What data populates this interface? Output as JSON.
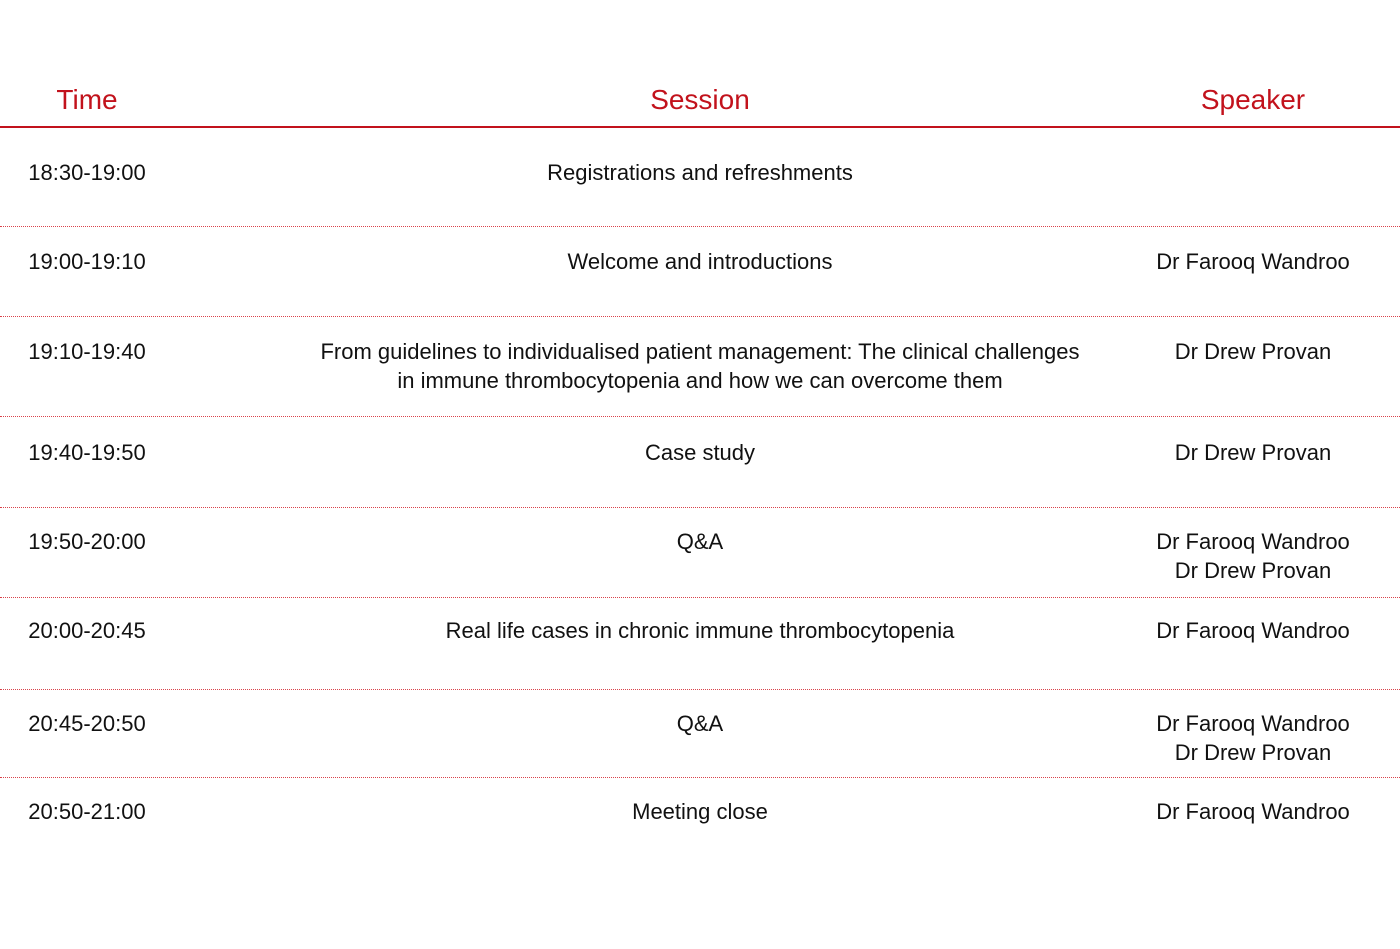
{
  "header": {
    "time": "Time",
    "session": "Session",
    "speaker": "Speaker"
  },
  "rows": [
    {
      "time": "18:30-19:00",
      "session": [
        "Registrations and refreshments"
      ],
      "speaker": []
    },
    {
      "time": "19:00-19:10",
      "session": [
        "Welcome and introductions"
      ],
      "speaker": [
        "Dr Farooq Wandroo"
      ]
    },
    {
      "time": "19:10-19:40",
      "session": [
        "From guidelines to individualised patient management: The clinical challenges",
        "in immune thrombocytopenia and how we can overcome them"
      ],
      "speaker": [
        "Dr Drew Provan"
      ]
    },
    {
      "time": "19:40-19:50",
      "session": [
        "Case study"
      ],
      "speaker": [
        "Dr Drew Provan"
      ]
    },
    {
      "time": "19:50-20:00",
      "session": [
        "Q&A"
      ],
      "speaker": [
        "Dr Farooq Wandroo",
        "Dr Drew Provan"
      ]
    },
    {
      "time": "20:00-20:45",
      "session": [
        "Real life cases in chronic immune thrombocytopenia"
      ],
      "speaker": [
        "Dr Farooq Wandroo"
      ]
    },
    {
      "time": "20:45-20:50",
      "session": [
        "Q&A"
      ],
      "speaker": [
        "Dr Farooq Wandroo",
        "Dr Drew Provan"
      ]
    },
    {
      "time": "20:50-21:00",
      "session": [
        "Meeting close"
      ],
      "speaker": [
        "Dr Farooq Wandroo"
      ]
    }
  ],
  "colors": {
    "accent": "#c2121c",
    "text": "#111111",
    "divider": "#d9434b"
  }
}
